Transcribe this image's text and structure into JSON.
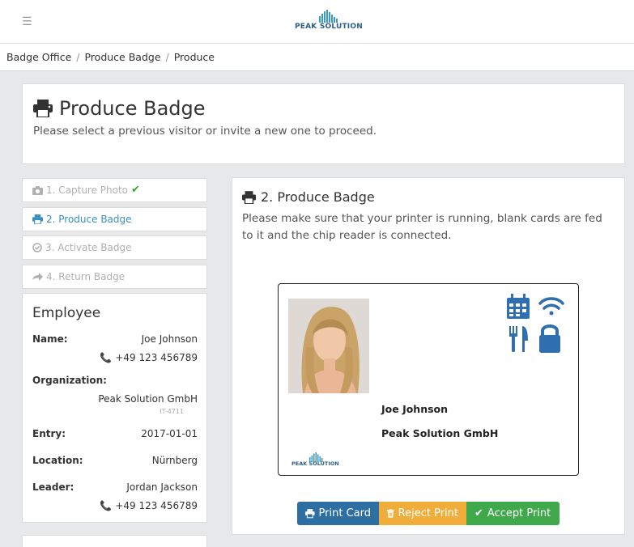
{
  "header": {
    "logo_text": "PEAK SOLUTION"
  },
  "breadcrumb": [
    "Badge Office",
    "Produce Badge",
    "Produce"
  ],
  "page": {
    "title": "Produce Badge",
    "subtitle": "Please select a previous visitor or invite a new one to proceed."
  },
  "steps": [
    {
      "label": "1. Capture Photo",
      "icon": "camera-icon",
      "state": "done"
    },
    {
      "label": "2. Produce Badge",
      "icon": "printer-icon",
      "state": "active"
    },
    {
      "label": "3. Activate Badge",
      "icon": "check-circle-icon",
      "state": "pending"
    },
    {
      "label": "4. Return Badge",
      "icon": "arrow-right-icon",
      "state": "pending"
    }
  ],
  "employee": {
    "heading": "Employee",
    "name_label": "Name:",
    "name": "Joe Johnson",
    "phone": "+49 123 456789",
    "org_label": "Organization:",
    "org": "Peak Solution GmbH",
    "org_id": "IT-4711",
    "entry_label": "Entry:",
    "entry": "2017-01-01",
    "location_label": "Location:",
    "location": "Nürnberg",
    "leader_label": "Leader:",
    "leader": "Jordan Jackson",
    "leader_phone": "+49 123 456789"
  },
  "produce": {
    "title": "2. Produce Badge",
    "description": "Please make sure that your printer is running, blank cards are fed to it and the chip reader is connected."
  },
  "badge": {
    "name": "Joe Johnson",
    "org": "Peak Solution GmbH",
    "logo_text": "PEAK SOLUTION",
    "icons": [
      "calendar-icon",
      "wifi-icon",
      "utensils-icon",
      "lock-icon"
    ]
  },
  "buttons": {
    "print": "Print Card",
    "reject": "Reject Print",
    "accept": "Accept Print"
  },
  "colors": {
    "accent": "#3a8fc0",
    "print": "#2d6ea3",
    "reject": "#f0ad3a",
    "accept": "#3fa84a",
    "badge_icons": "#2f6fb0"
  }
}
